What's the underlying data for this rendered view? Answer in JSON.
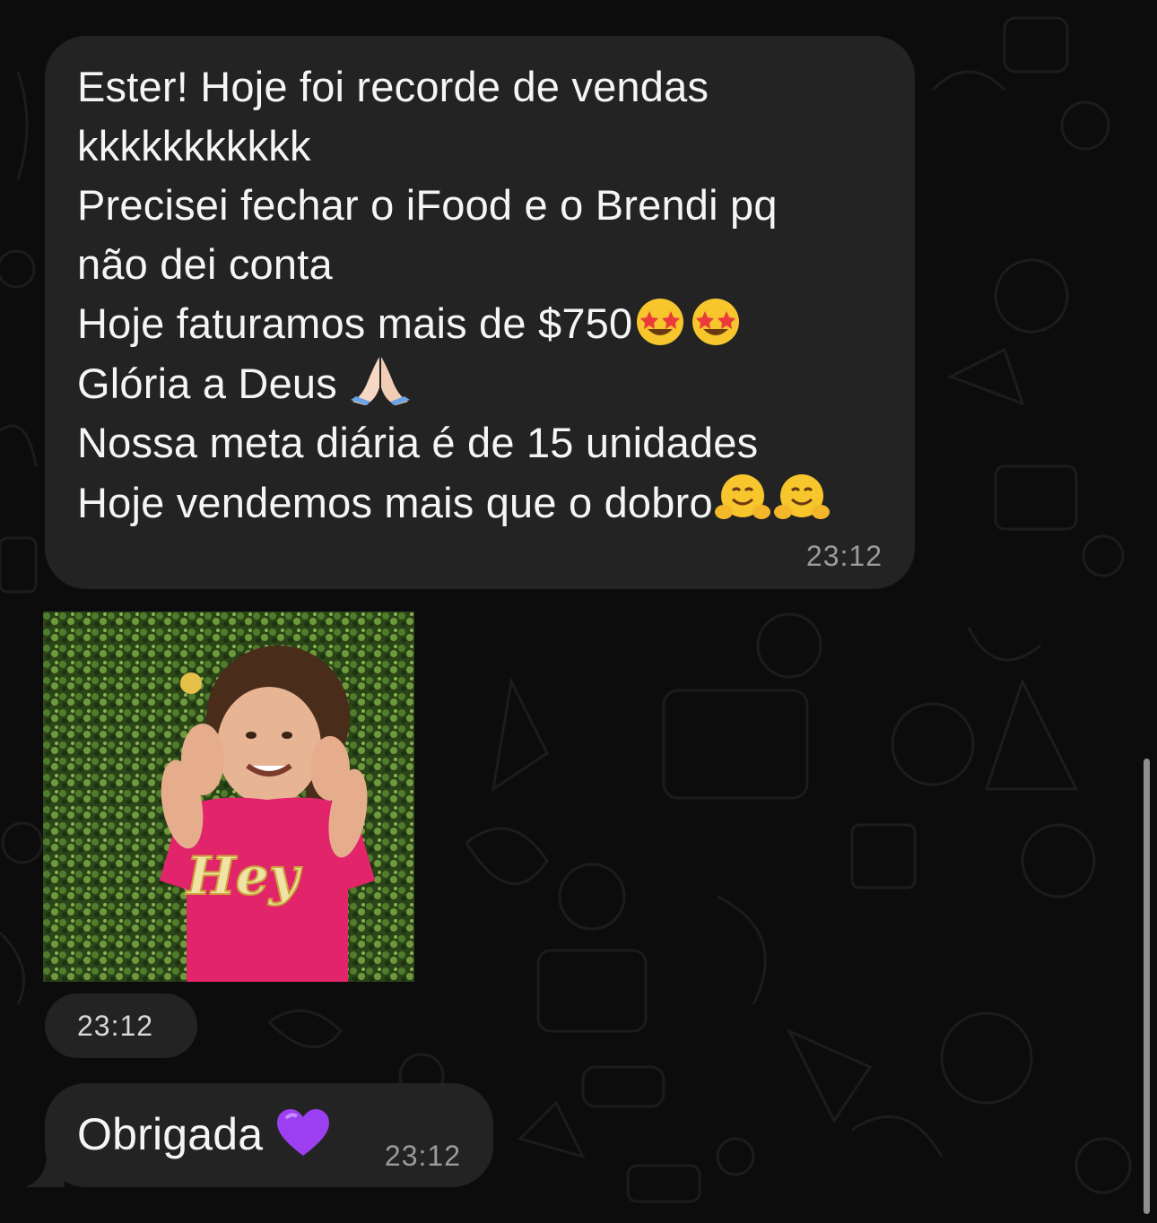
{
  "messages": [
    {
      "lines": [
        "Ester! Hoje foi recorde de vendas",
        "kkkkkkkkkkk",
        "Precisei fechar o iFood e o Brendi pq",
        "não dei conta",
        "Hoje faturamos mais de $750",
        "Glória a Deus",
        "Nossa meta diária é de 15 unidades",
        "Hoje vendemos mais que o dobro"
      ],
      "time": "23:12"
    },
    {
      "image_text": "Hey",
      "time": "23:12"
    },
    {
      "text": "Obrigada",
      "time": "23:12"
    }
  ],
  "icons": {
    "star_struck": "star-struck-emoji",
    "praying": "folded-hands-emoji",
    "hug": "hugging-face-emoji",
    "heart": "purple-heart-emoji"
  },
  "colors": {
    "background": "#0c0c0c",
    "bubble": "#232323",
    "text": "#f5f5f5",
    "timestamp": "#9b9b9b",
    "heart": "#9b3ff0"
  }
}
